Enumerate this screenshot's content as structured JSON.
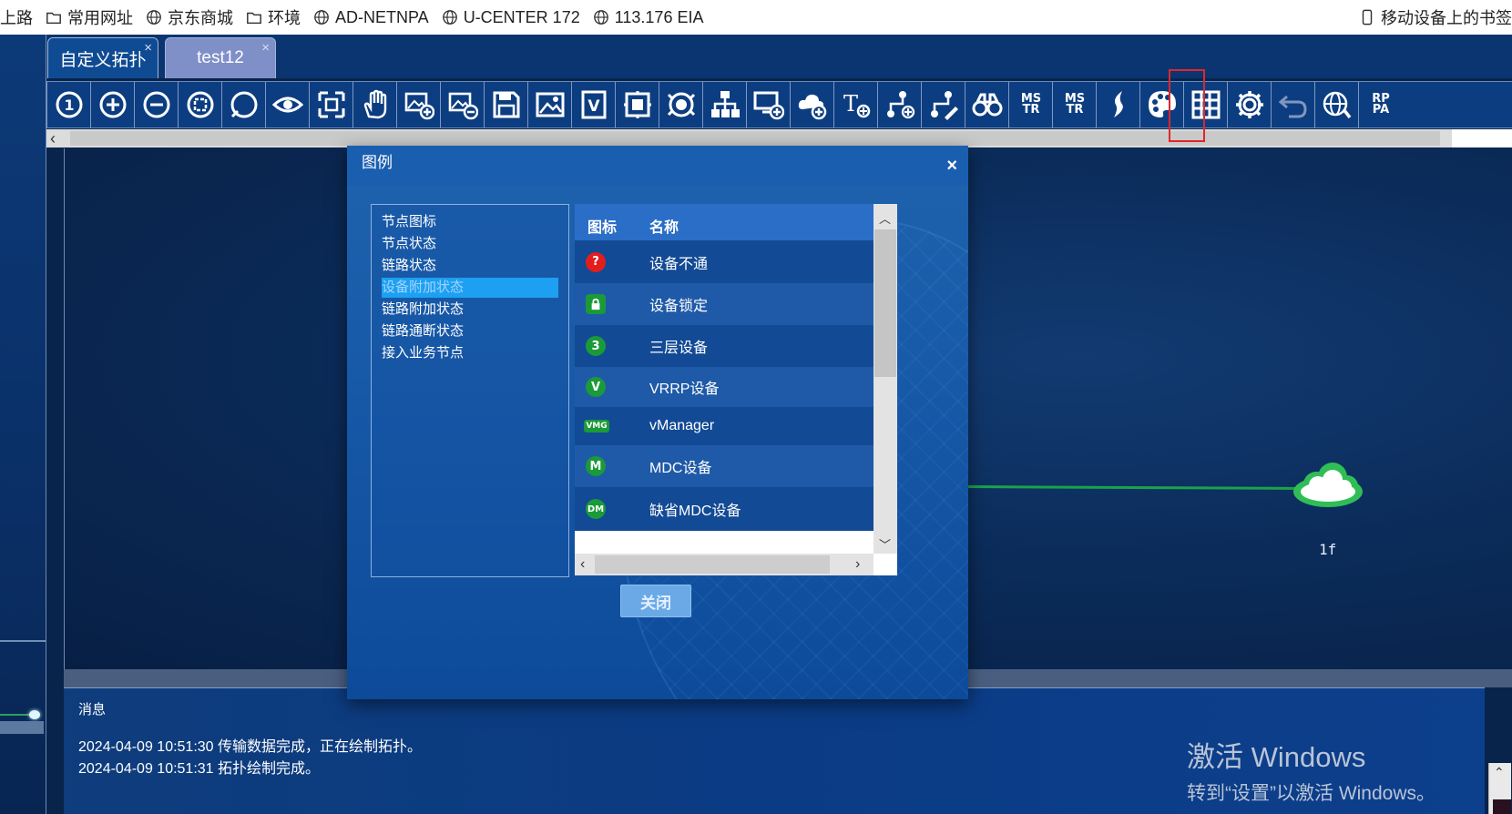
{
  "bookmarks": {
    "items": [
      {
        "icon": "folder-icon",
        "label": "上路"
      },
      {
        "icon": "folder-icon",
        "label": "常用网址"
      },
      {
        "icon": "globe-icon",
        "label": "京东商城"
      },
      {
        "icon": "folder-icon",
        "label": "环境"
      },
      {
        "icon": "globe-icon",
        "label": "AD-NETNPA"
      },
      {
        "icon": "globe-icon",
        "label": "U-CENTER 172"
      },
      {
        "icon": "globe-icon",
        "label": "113.176 EIA"
      }
    ],
    "mobile": {
      "icon": "mobile-icon",
      "label": "移动设备上的书签"
    }
  },
  "tabs": [
    {
      "label": "自定义拓扑",
      "close": "×"
    },
    {
      "label": "test12",
      "close": "×"
    }
  ],
  "toolbar": {
    "buttons": [
      {
        "name": "toolbar-1to1-icon"
      },
      {
        "name": "zoom-in-icon"
      },
      {
        "name": "zoom-out-icon"
      },
      {
        "name": "zoom-fit-icon"
      },
      {
        "name": "circle-select-icon"
      },
      {
        "name": "eye-icon"
      },
      {
        "name": "fullscreen-icon"
      },
      {
        "name": "hand-pan-icon"
      },
      {
        "name": "add-image-icon"
      },
      {
        "name": "remove-image-icon"
      },
      {
        "name": "save-icon"
      },
      {
        "name": "image-icon"
      },
      {
        "name": "v-frame-icon"
      },
      {
        "name": "square-frame-icon"
      },
      {
        "name": "circle-frame-icon"
      },
      {
        "name": "hierarchy-icon"
      },
      {
        "name": "add-device-icon"
      },
      {
        "name": "add-cloud-icon"
      },
      {
        "name": "text-tool-icon"
      },
      {
        "name": "add-link-icon"
      },
      {
        "name": "edit-link-icon"
      },
      {
        "name": "binoculars-icon"
      },
      {
        "name": "ms-tree-icon",
        "text": "MS\nTR"
      },
      {
        "name": "ms-settings-icon",
        "text": "MS\nTR"
      },
      {
        "name": "legend-icon"
      },
      {
        "name": "palette-icon"
      },
      {
        "name": "grid-icon"
      },
      {
        "name": "settings-gear-icon"
      },
      {
        "name": "undo-icon"
      },
      {
        "name": "global-network-icon"
      },
      {
        "name": "rp-pa-icon",
        "text": "RP\nPA"
      }
    ]
  },
  "canvas": {
    "node_label": "1f"
  },
  "message_panel": {
    "title": "消息",
    "lines": [
      "2024-04-09 10:51:30 传输数据完成，正在绘制拓扑。",
      "2024-04-09 10:51:31 拓扑绘制完成。"
    ]
  },
  "watermark": {
    "line1": "激活 Windows",
    "line2": "转到“设置”以激活 Windows。"
  },
  "dialog": {
    "title": "图例",
    "close_icon": "×",
    "categories": [
      "节点图标",
      "节点状态",
      "链路状态",
      "设备附加状态",
      "链路附加状态",
      "链路通断状态",
      "接入业务节点"
    ],
    "selected_index": 3,
    "table_headers": {
      "icon": "图标",
      "name": "名称"
    },
    "rows": [
      {
        "icon": "question-red-icon",
        "glyph": "?",
        "name": "设备不通"
      },
      {
        "icon": "lock-green-icon",
        "glyph": "🔒",
        "name": "设备锁定"
      },
      {
        "icon": "layer3-green-icon",
        "glyph": "3",
        "name": "三层设备"
      },
      {
        "icon": "vrrp-green-icon",
        "glyph": "V",
        "name": "VRRP设备"
      },
      {
        "icon": "vmg-green-icon",
        "glyph": "VMG",
        "name": "vManager"
      },
      {
        "icon": "mdc-green-icon",
        "glyph": "M",
        "name": "MDC设备"
      },
      {
        "icon": "default-mdc-green-icon",
        "glyph": "DM",
        "name": "缺省MDC设备"
      }
    ],
    "close_button": "关闭"
  },
  "colors": {
    "toolbar_bg": "#0c3d80",
    "dialog_bg": "#1a5eb0",
    "selected_category": "#1ea0f2",
    "link_green": "#1aa24a",
    "highlight_red": "#e0262a"
  }
}
